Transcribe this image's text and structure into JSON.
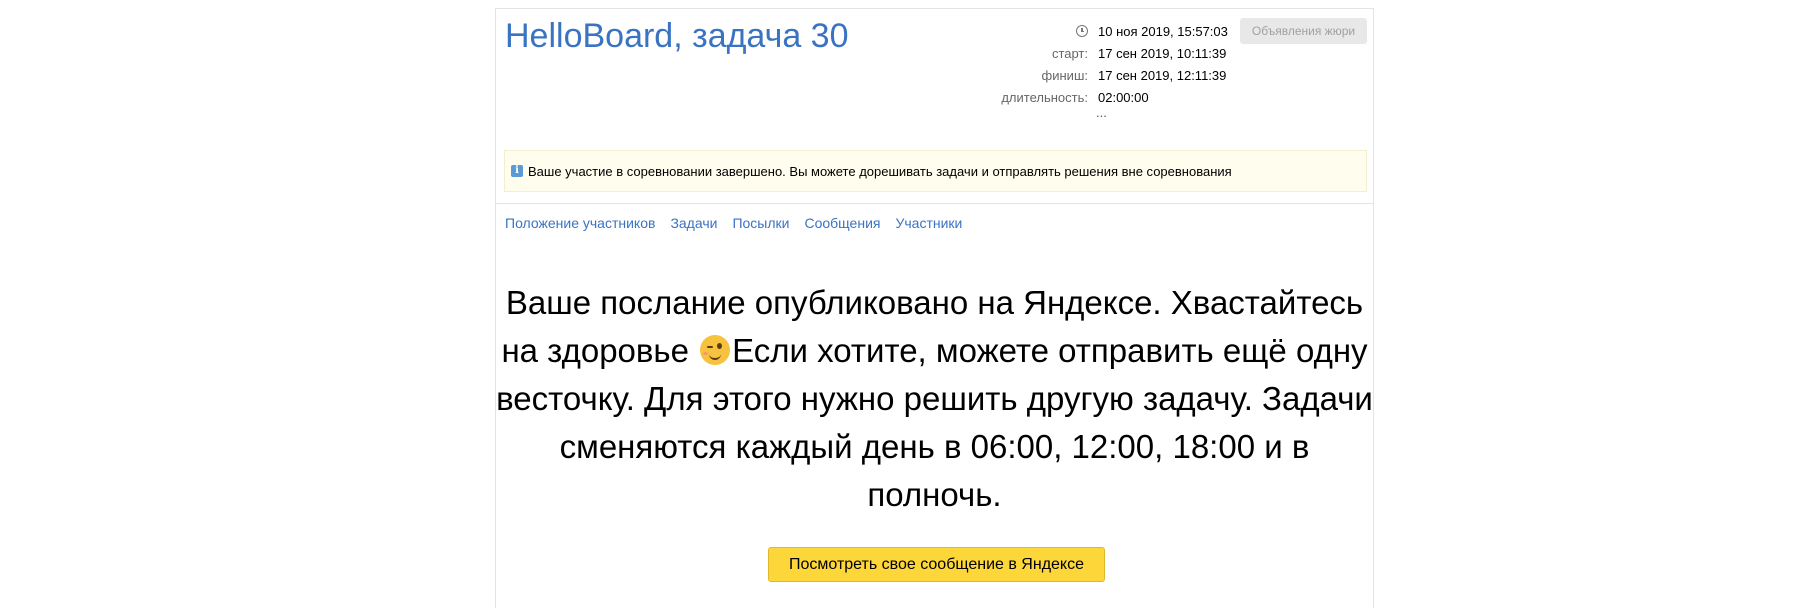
{
  "header": {
    "title": "HelloBoard, задача 30",
    "current_time": "10 ноя 2019, 15:57:03",
    "start_label": "старт:",
    "start_value": "17 сен 2019, 10:11:39",
    "finish_label": "финиш:",
    "finish_value": "17 сен 2019, 12:11:39",
    "duration_label": "длительность:",
    "duration_value": "02:00:00",
    "ellipsis": "...",
    "jury_button": "Объявления жюри"
  },
  "notice": {
    "text": "Ваше участие в соревновании завершено. Вы можете дорешивать задачи и отправлять решения вне соревнования",
    "icon": "info-icon"
  },
  "nav": {
    "items": [
      {
        "label": "Положение участников"
      },
      {
        "label": "Задачи"
      },
      {
        "label": "Посылки"
      },
      {
        "label": "Сообщения"
      },
      {
        "label": "Участники"
      }
    ]
  },
  "message": {
    "line1": "Ваше послание опубликовано на Яндексе. Хвастайтесь",
    "line2_before": "на здоровье ",
    "line2_after": "Если хотите, можете отправить ещё одну",
    "line3": "весточку. Для этого нужно решить другую задачу. Задачи",
    "line4": "сменяются каждый день в 06:00, 12:00, 18:00 и в",
    "line5": "полночь.",
    "emoji": "wink-emoji-icon"
  },
  "action": {
    "button_label": "Посмотреть свое сообщение в Яндексе"
  },
  "colors": {
    "link": "#3a73c2",
    "button": "#fdd63a",
    "notice_bg": "#fffdee"
  }
}
